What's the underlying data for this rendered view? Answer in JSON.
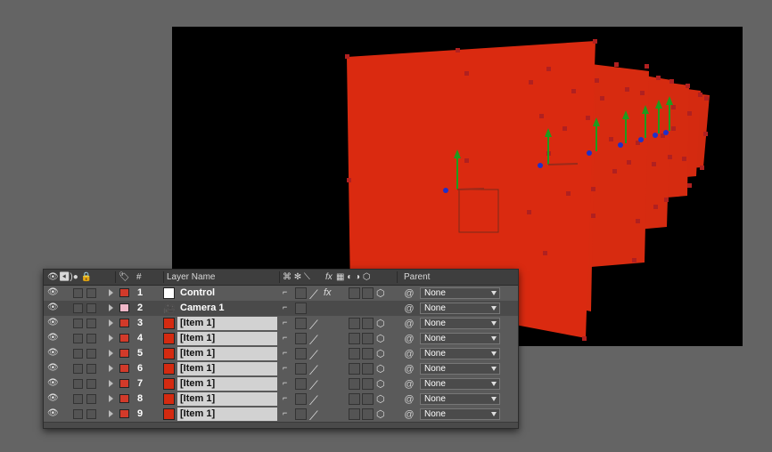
{
  "timeline": {
    "headers": {
      "hash": "#",
      "layer_name": "Layer Name",
      "parent": "Parent",
      "fx": "fx"
    },
    "layers": [
      {
        "num": "1",
        "name": "Control",
        "label_color": "#d23a2a",
        "icon_color": "#ffffff",
        "kind": "null",
        "parent": "None"
      },
      {
        "num": "2",
        "name": "Camera 1",
        "label_color": "#f0b8c8",
        "icon_color": "#222222",
        "kind": "camera",
        "parent": "None"
      },
      {
        "num": "3",
        "name": "[Item 1]",
        "label_color": "#d23a2a",
        "icon_color": "#d42a10",
        "kind": "solid",
        "parent": "None"
      },
      {
        "num": "4",
        "name": "[Item 1]",
        "label_color": "#d23a2a",
        "icon_color": "#d42a10",
        "kind": "solid",
        "parent": "None"
      },
      {
        "num": "5",
        "name": "[Item 1]",
        "label_color": "#d23a2a",
        "icon_color": "#d42a10",
        "kind": "solid",
        "parent": "None"
      },
      {
        "num": "6",
        "name": "[Item 1]",
        "label_color": "#d23a2a",
        "icon_color": "#d42a10",
        "kind": "solid",
        "parent": "None"
      },
      {
        "num": "7",
        "name": "[Item 1]",
        "label_color": "#d23a2a",
        "icon_color": "#d42a10",
        "kind": "solid",
        "parent": "None"
      },
      {
        "num": "8",
        "name": "[Item 1]",
        "label_color": "#d23a2a",
        "icon_color": "#d42a10",
        "kind": "solid",
        "parent": "None"
      },
      {
        "num": "9",
        "name": "[Item 1]",
        "label_color": "#d23a2a",
        "icon_color": "#d42a10",
        "kind": "solid",
        "parent": "None"
      }
    ]
  },
  "colors": {
    "solid_red": "#d42a10",
    "handle": "#b02020",
    "axis_y": "#1e9c1e",
    "axis_z": "#2030c8",
    "background": "#646464"
  }
}
